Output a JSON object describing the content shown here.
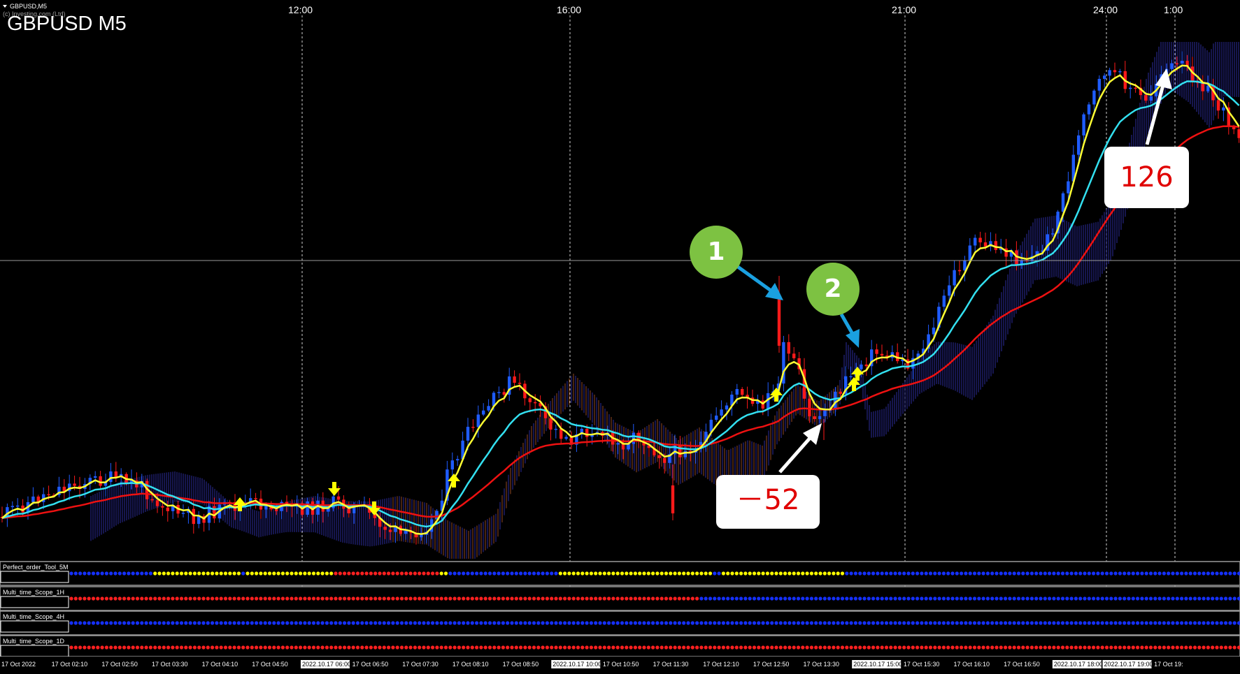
{
  "window": {
    "tab_label": "GBPUSD,M5",
    "copyright": "(c) Investing.com (Ltd)",
    "symbol_title": "GBPUSD M5"
  },
  "time_axis_top": [
    "12:00",
    "16:00",
    "21:00",
    "24:00",
    "1:00"
  ],
  "time_axis_bottom": [
    {
      "label": "17 Oct 2022",
      "boxed": false
    },
    {
      "label": "17 Oct 02:10",
      "boxed": false
    },
    {
      "label": "17 Oct 02:50",
      "boxed": false
    },
    {
      "label": "17 Oct 03:30",
      "boxed": false
    },
    {
      "label": "17 Oct 04:10",
      "boxed": false
    },
    {
      "label": "17 Oct 04:50",
      "boxed": false
    },
    {
      "label": "2022.10.17 06:00",
      "boxed": true
    },
    {
      "label": "17 Oct 06:50",
      "boxed": false
    },
    {
      "label": "17 Oct 07:30",
      "boxed": false
    },
    {
      "label": "17 Oct 08:10",
      "boxed": false
    },
    {
      "label": "17 Oct 08:50",
      "boxed": false
    },
    {
      "label": "2022.10.17 10:00",
      "boxed": true
    },
    {
      "label": "17 Oct 10:50",
      "boxed": false
    },
    {
      "label": "17 Oct 11:30",
      "boxed": false
    },
    {
      "label": "17 Oct 12:10",
      "boxed": false
    },
    {
      "label": "17 Oct 12:50",
      "boxed": false
    },
    {
      "label": "17 Oct 13:30",
      "boxed": false
    },
    {
      "label": "2022.10.17 15:00",
      "boxed": true
    },
    {
      "label": "17 Oct 15:30",
      "boxed": false
    },
    {
      "label": "17 Oct 16:10",
      "boxed": false
    },
    {
      "label": "17 Oct 16:50",
      "boxed": false
    },
    {
      "label": "2022.10.17 18:00",
      "boxed": true
    },
    {
      "label": "2022.10.17 19:00",
      "boxed": true
    },
    {
      "label": "17 Oct 19:",
      "boxed": false
    }
  ],
  "indicators": [
    {
      "name": "Perfect_order_Tool_5M"
    },
    {
      "name": "Multi_time_Scope_1H"
    },
    {
      "name": "Multi_time_Scope_4H"
    },
    {
      "name": "Multi_time_Scope_1D"
    }
  ],
  "annotations": {
    "marker_1": "1",
    "marker_2": "2",
    "callout_loss": "－52",
    "callout_gain": "126"
  },
  "colors": {
    "bull_candle": "#1f5cff",
    "bear_candle": "#ff1a1a",
    "ema_fast": "#ffff33",
    "ema_mid": "#33e0f0",
    "ema_slow": "#ee1111",
    "marker_green": "#7dc242",
    "arrow_blue": "#1aa0e0",
    "signal_arrow": "#ffff00"
  }
}
